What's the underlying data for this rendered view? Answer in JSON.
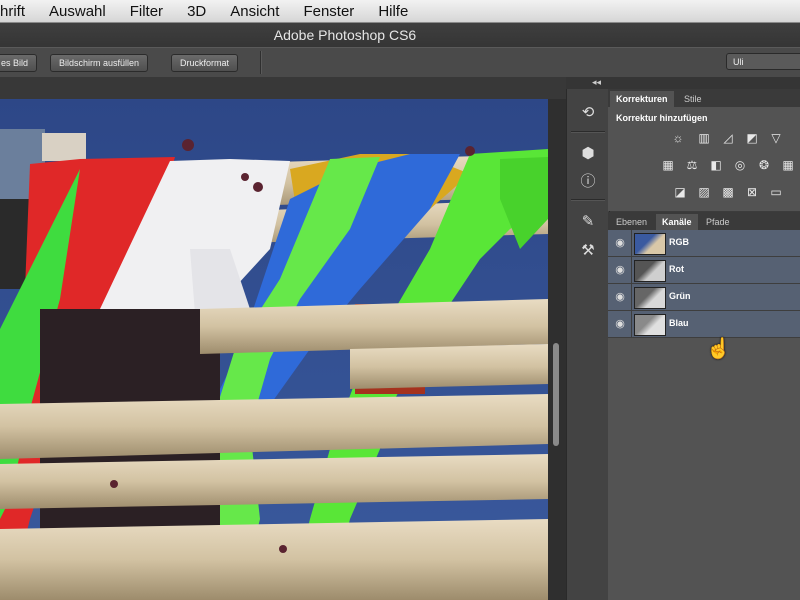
{
  "menu": [
    "hrift",
    "Auswahl",
    "Filter",
    "3D",
    "Ansicht",
    "Fenster",
    "Hilfe"
  ],
  "app_title": "Adobe Photoshop CS6",
  "options_bar": {
    "btn_fit": "es Bild",
    "btn_fill": "Bildschirm ausfüllen",
    "btn_print": "Druckformat",
    "workspace": "Uli"
  },
  "collapse_arrows": "◂◂",
  "adjustments_panel": {
    "tabs": [
      "Korrekturen",
      "Stile"
    ],
    "heading": "Korrektur hinzufügen",
    "icons": [
      "brightness-icon",
      "levels-icon",
      "curves-icon",
      "exposure-icon",
      "vibrance-icon",
      "hue-saturation-icon",
      "color-balance-icon",
      "black-white-icon",
      "photo-filter-icon",
      "channel-mixer-icon",
      "color-lookup-icon",
      "invert-icon",
      "posterize-icon",
      "threshold-icon",
      "selective-color-icon",
      "gradient-map-icon"
    ]
  },
  "channels_panel": {
    "tabs": [
      "Ebenen",
      "Kanäle",
      "Pfade"
    ],
    "channels": [
      {
        "name": "RGB"
      },
      {
        "name": "Rot"
      },
      {
        "name": "Grün"
      },
      {
        "name": "Blau"
      }
    ]
  },
  "colors": {
    "sky": "#2e4a8a",
    "selected_row": "#566173"
  }
}
